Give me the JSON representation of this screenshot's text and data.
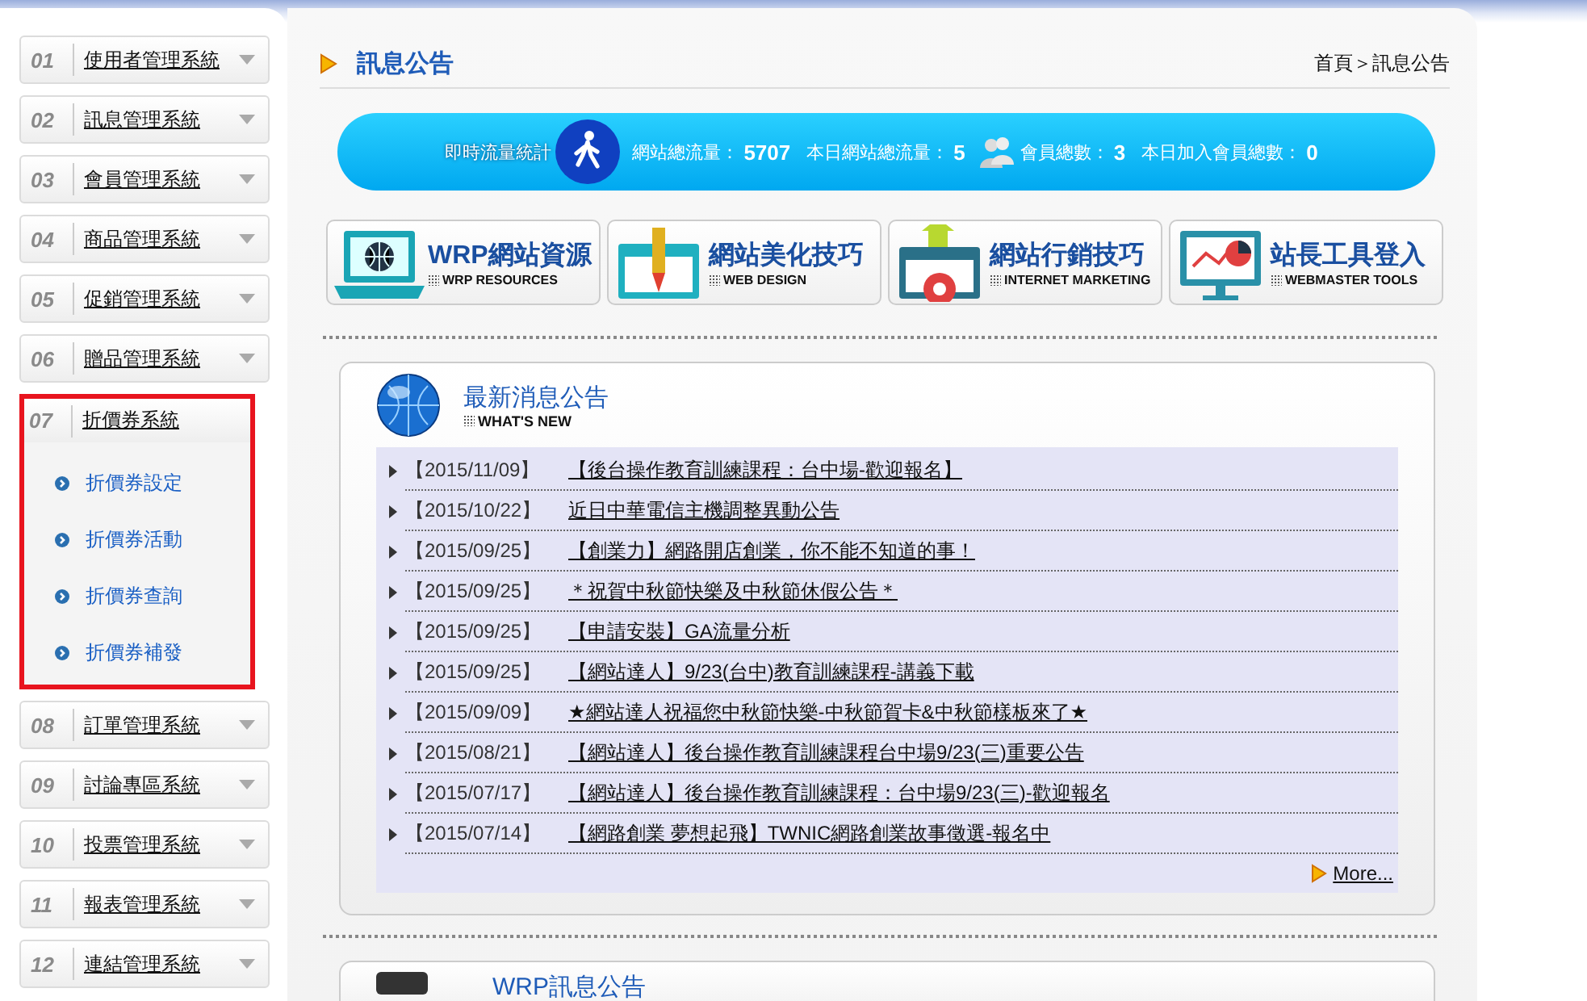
{
  "sidebar": {
    "items": [
      {
        "number": "01",
        "label": "使用者管理系統",
        "expanded": false,
        "highlighted": false
      },
      {
        "number": "02",
        "label": "訊息管理系統",
        "expanded": false,
        "highlighted": false
      },
      {
        "number": "03",
        "label": "會員管理系統",
        "expanded": false,
        "highlighted": false
      },
      {
        "number": "04",
        "label": "商品管理系統",
        "expanded": false,
        "highlighted": false
      },
      {
        "number": "05",
        "label": "促銷管理系統",
        "expanded": false,
        "highlighted": false
      },
      {
        "number": "06",
        "label": "贈品管理系統",
        "expanded": false,
        "highlighted": false
      },
      {
        "number": "07",
        "label": "折價券系統",
        "expanded": true,
        "highlighted": true,
        "children": [
          {
            "label": "折價券設定"
          },
          {
            "label": "折價券活動"
          },
          {
            "label": "折價券查詢"
          },
          {
            "label": "折價券補發"
          }
        ]
      },
      {
        "number": "08",
        "label": "訂單管理系統",
        "expanded": false,
        "highlighted": false
      },
      {
        "number": "09",
        "label": "討論專區系統",
        "expanded": false,
        "highlighted": false
      },
      {
        "number": "10",
        "label": "投票管理系統",
        "expanded": false,
        "highlighted": false
      },
      {
        "number": "11",
        "label": "報表管理系統",
        "expanded": false,
        "highlighted": false
      },
      {
        "number": "12",
        "label": "連結管理系統",
        "expanded": false,
        "highlighted": false
      }
    ]
  },
  "header": {
    "title": "訊息公告",
    "breadcrumb": "首頁＞訊息公告"
  },
  "stats": {
    "label": "即時流量統計",
    "items": [
      {
        "label": "網站總流量：",
        "value": "5707",
        "has_icon": false
      },
      {
        "label": "本日網站總流量：",
        "value": "5",
        "has_icon": false
      },
      {
        "label": "會員總數：",
        "value": "3",
        "has_icon": true
      },
      {
        "label": "本日加入會員總數：",
        "value": "0",
        "has_icon": false
      }
    ]
  },
  "tiles": [
    {
      "kind": "laptop",
      "title": "WRP網站資源",
      "subtitle": "WRP RESOURCES"
    },
    {
      "kind": "design",
      "title": "網站美化技巧",
      "subtitle": "WEB DESIGN"
    },
    {
      "kind": "marketing",
      "title": "網站行銷技巧",
      "subtitle": "INTERNET MARKETING"
    },
    {
      "kind": "tools",
      "title": "站長工具登入",
      "subtitle": "WEBMASTER TOOLS"
    }
  ],
  "news": {
    "title": "最新消息公告",
    "subtitle": "WHAT'S NEW",
    "items": [
      {
        "date": "【2015/11/09】",
        "title": "【後台操作教育訓練課程：台中場-歡迎報名】"
      },
      {
        "date": "【2015/10/22】",
        "title": "近日中華電信主機調整異動公告"
      },
      {
        "date": "【2015/09/25】",
        "title": "【創業力】網路開店創業，你不能不知道的事！"
      },
      {
        "date": "【2015/09/25】",
        "title": "＊祝賀中秋節快樂及中秋節休假公告＊"
      },
      {
        "date": "【2015/09/25】",
        "title": "【申請安裝】GA流量分析"
      },
      {
        "date": "【2015/09/25】",
        "title": "【網站達人】9/23(台中)教育訓練課程-講義下載"
      },
      {
        "date": "【2015/09/09】",
        "title": "★網站達人祝福您中秋節快樂-中秋節賀卡&中秋節樣板來了★"
      },
      {
        "date": "【2015/08/21】",
        "title": "【網站達人】後台操作教育訓練課程台中場9/23(三)重要公告"
      },
      {
        "date": "【2015/07/17】",
        "title": "【網站達人】後台操作教育訓練課程：台中場9/23(三)-歡迎報名"
      },
      {
        "date": "【2015/07/14】",
        "title": "【網路創業 夢想起飛】TWNIC網路創業故事徵選-報名中"
      }
    ],
    "more": "More..."
  },
  "wrp_news": {
    "title": "WRP訊息公告"
  }
}
